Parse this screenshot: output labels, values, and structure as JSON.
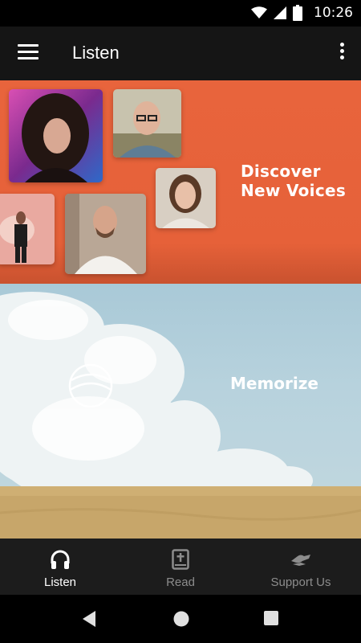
{
  "status_bar": {
    "time": "10:26"
  },
  "app_bar": {
    "title": "Listen",
    "menu_icon": "hamburger-menu-icon",
    "more_icon": "more-vertical-icon"
  },
  "discover": {
    "title_line1": "Discover",
    "title_line2": "New Voices",
    "background": "#e8643c"
  },
  "memorize": {
    "title": "Memorize",
    "logo_icon": "memorize-logo-icon"
  },
  "bottom_nav": {
    "items": [
      {
        "label": "Listen",
        "icon": "headphones-icon",
        "active": true
      },
      {
        "label": "Read",
        "icon": "bible-icon",
        "active": false
      },
      {
        "label": "Support Us",
        "icon": "handshake-icon",
        "active": false
      }
    ]
  },
  "system_nav": {
    "back_icon": "back-triangle-icon",
    "home_icon": "home-circle-icon",
    "recents_icon": "recents-square-icon"
  }
}
